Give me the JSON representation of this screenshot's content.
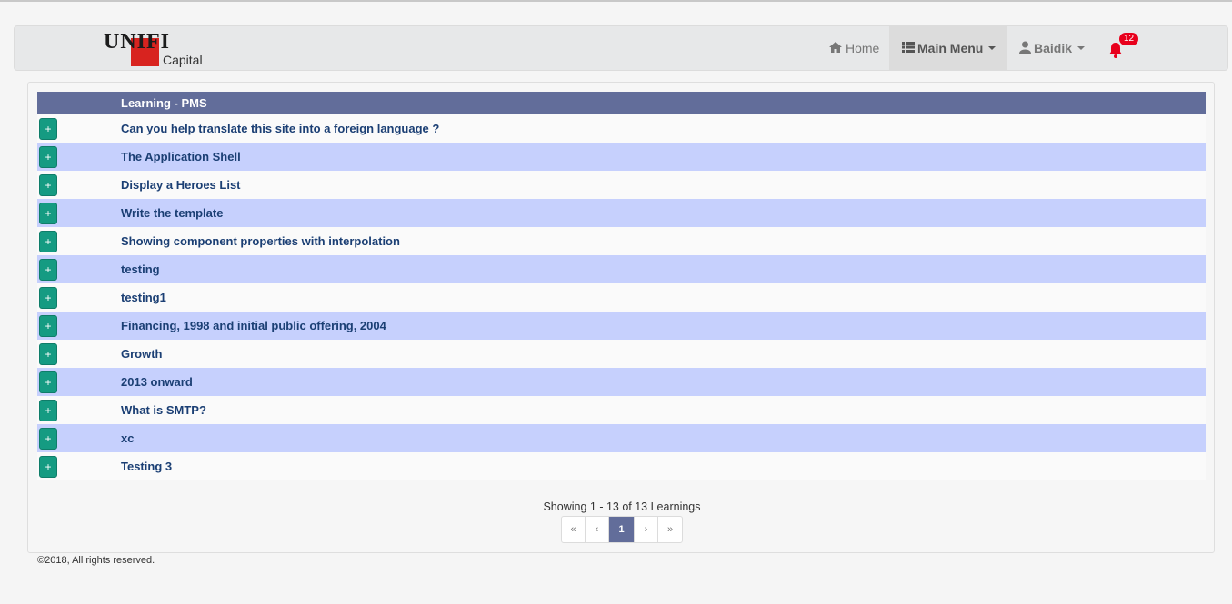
{
  "brand": {
    "name": "UNIFI",
    "sub": "Capital"
  },
  "nav": {
    "home": "Home",
    "main_menu": "Main Menu",
    "user": "Baidik",
    "notifications": "12"
  },
  "table": {
    "header": "Learning - PMS",
    "expand_label": "+",
    "rows": [
      "Can you help translate this site into a foreign language ?",
      "The Application Shell",
      "Display a Heroes List",
      "Write the template",
      "Showing component properties with interpolation",
      "testing",
      "testing1",
      "Financing, 1998 and initial public offering, 2004",
      "Growth",
      "2013 onward",
      "What is SMTP?",
      "xc",
      "Testing 3"
    ]
  },
  "pagination": {
    "summary": "Showing 1 - 13 of 13 Learnings",
    "first": "«",
    "prev": "‹",
    "current": "1",
    "next": "›",
    "last": "»"
  },
  "footer": "©2018, All rights reserved.",
  "colors": {
    "header_bg": "#626d9a",
    "row_alt": "#c6d0fd",
    "button": "#159b82",
    "badge": "#e8001c"
  }
}
